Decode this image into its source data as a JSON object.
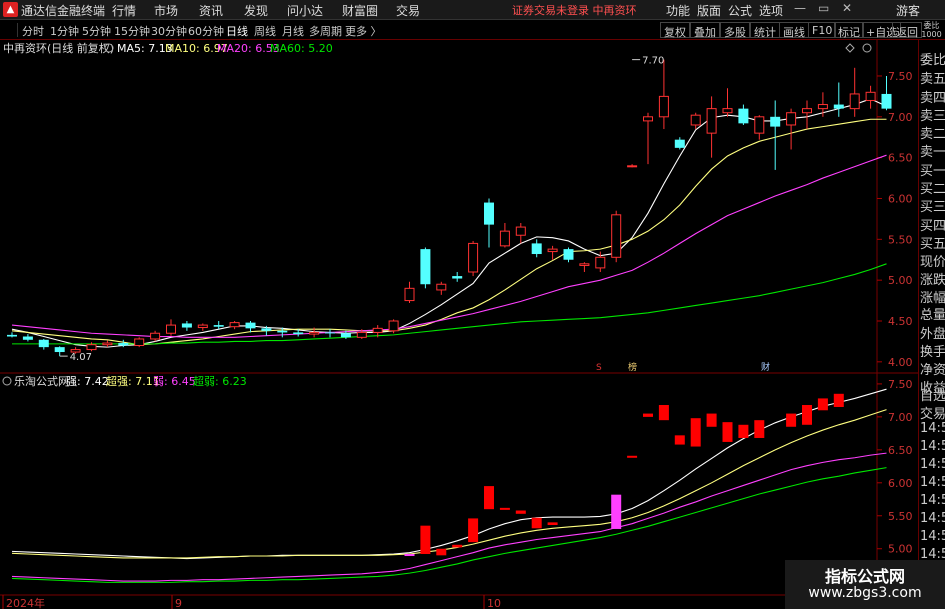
{
  "app": {
    "icon": "app-logo-icon",
    "title": "通达信金融终端"
  },
  "menus": [
    "行情",
    "市场",
    "资讯",
    "发现",
    "问小达",
    "财富圈",
    "交易"
  ],
  "status_text": "证券交易未登录  中再资环",
  "right_menus": [
    "功能",
    "版面",
    "公式",
    "选项"
  ],
  "window_controls": [
    "—",
    "▭",
    "✕"
  ],
  "guest_label": "游客",
  "periods": [
    "分时",
    "1分钟",
    "5分钟",
    "15分钟",
    "30分钟",
    "60分钟",
    "日线",
    "周线",
    "月线",
    "多周期",
    "更多 〉"
  ],
  "active_period": "日线",
  "toolbar_right": [
    "复权",
    "叠加",
    "多股",
    "统计",
    "画线",
    "F10",
    "标记",
    "+自选",
    "返回"
  ],
  "side_top": [
    "委比",
    "1000"
  ],
  "side_items": [
    "委比",
    "卖五",
    "卖四",
    "卖三",
    "卖二",
    "卖一",
    "买一",
    "买二",
    "买三",
    "买四",
    "买五",
    "现价",
    "涨跌",
    "涨幅",
    "总量",
    "外盘",
    "换手",
    "净资",
    "收益",
    "自选",
    "交易",
    "14:56",
    "14:56",
    "14:56",
    "14:56",
    "14:56",
    "14:56",
    "14:56",
    "14:56"
  ],
  "main_legend": {
    "stock": "中再资环(日线 前复权)",
    "ma5": "MA5: 7.13",
    "ma10": "MA10: 6.97",
    "ma20": "MA20: 6.53",
    "ma60": "MA60: 5.20"
  },
  "sub_legend": {
    "name": "乐淘公式网",
    "strong": "强: 7.42",
    "super_strong": "超强: 7.11",
    "weak": "弱: 6.45",
    "super_weak": "超弱: 6.23"
  },
  "markers": {
    "s_mark": "S",
    "bang_mark": "榜",
    "cai_mark": "财"
  },
  "x_labels": [
    "2024年",
    "9",
    "10"
  ],
  "colors": {
    "up": "#ff3232",
    "down": "#54ffff",
    "ma5": "#ffffff",
    "ma10": "#ffff80",
    "ma20": "#ff40ff",
    "ma60": "#00e600",
    "sub_red": "#ff0000",
    "sub_magenta": "#ff40ff"
  },
  "watermark": {
    "logo": "指标公式网",
    "url": "www.zbgs3.com"
  },
  "chart_data": [
    {
      "type": "candlestick",
      "title": "中再资环(日线 前复权)",
      "y_ticks": [
        4.0,
        4.5,
        5.0,
        5.5,
        6.0,
        6.5,
        7.0,
        7.5
      ],
      "ylim": [
        3.9,
        7.72
      ],
      "annotations": [
        {
          "label": "7.70",
          "index": 39,
          "price": 7.7
        },
        {
          "label": "4.07",
          "index": 3,
          "price": 4.07
        }
      ],
      "ohlc": [
        [
          4.33,
          4.36,
          4.3,
          4.31
        ],
        [
          4.31,
          4.34,
          4.25,
          4.27
        ],
        [
          4.27,
          4.28,
          4.15,
          4.18
        ],
        [
          4.18,
          4.19,
          4.07,
          4.12
        ],
        [
          4.12,
          4.18,
          4.1,
          4.15
        ],
        [
          4.15,
          4.24,
          4.13,
          4.21
        ],
        [
          4.21,
          4.26,
          4.18,
          4.23
        ],
        [
          4.23,
          4.27,
          4.18,
          4.2
        ],
        [
          4.2,
          4.3,
          4.18,
          4.28
        ],
        [
          4.28,
          4.38,
          4.25,
          4.35
        ],
        [
          4.35,
          4.52,
          4.32,
          4.45
        ],
        [
          4.47,
          4.5,
          4.38,
          4.42
        ],
        [
          4.42,
          4.47,
          4.38,
          4.45
        ],
        [
          4.45,
          4.5,
          4.4,
          4.43
        ],
        [
          4.43,
          4.5,
          4.4,
          4.48
        ],
        [
          4.48,
          4.5,
          4.36,
          4.41
        ],
        [
          4.41,
          4.44,
          4.32,
          4.38
        ],
        [
          4.38,
          4.42,
          4.3,
          4.36
        ],
        [
          4.36,
          4.4,
          4.31,
          4.34
        ],
        [
          4.34,
          4.42,
          4.3,
          4.36
        ],
        [
          4.36,
          4.4,
          4.3,
          4.35
        ],
        [
          4.35,
          4.38,
          4.28,
          4.3
        ],
        [
          4.3,
          4.4,
          4.28,
          4.36
        ],
        [
          4.36,
          4.45,
          4.3,
          4.41
        ],
        [
          4.38,
          4.52,
          4.35,
          4.5
        ],
        [
          4.75,
          4.98,
          4.72,
          4.9
        ],
        [
          5.38,
          5.4,
          4.9,
          4.95
        ],
        [
          4.88,
          4.98,
          4.82,
          4.95
        ],
        [
          5.05,
          5.1,
          4.98,
          5.02
        ],
        [
          5.1,
          5.48,
          5.05,
          5.45
        ],
        [
          5.95,
          6.0,
          5.4,
          5.68
        ],
        [
          5.42,
          5.7,
          5.4,
          5.6
        ],
        [
          5.55,
          5.7,
          5.45,
          5.65
        ],
        [
          5.45,
          5.5,
          5.28,
          5.32
        ],
        [
          5.35,
          5.42,
          5.25,
          5.38
        ],
        [
          5.38,
          5.4,
          5.22,
          5.25
        ],
        [
          5.18,
          5.22,
          5.1,
          5.2
        ],
        [
          5.15,
          5.35,
          5.1,
          5.28
        ],
        [
          5.28,
          5.85,
          5.22,
          5.8
        ],
        [
          6.4,
          6.42,
          6.38,
          6.4
        ],
        [
          6.95,
          7.05,
          6.42,
          7.0
        ],
        [
          7.0,
          7.7,
          6.85,
          7.25
        ],
        [
          6.72,
          6.75,
          6.6,
          6.62
        ],
        [
          6.9,
          7.05,
          6.85,
          7.02
        ],
        [
          6.8,
          7.25,
          6.5,
          7.1
        ],
        [
          7.05,
          7.35,
          7.0,
          7.1
        ],
        [
          7.1,
          7.15,
          6.9,
          6.92
        ],
        [
          6.8,
          7.02,
          6.72,
          7.0
        ],
        [
          7.0,
          7.2,
          6.35,
          6.88
        ],
        [
          6.9,
          7.1,
          6.6,
          7.05
        ],
        [
          7.05,
          7.2,
          6.85,
          7.1
        ],
        [
          7.1,
          7.3,
          7.0,
          7.15
        ],
        [
          7.15,
          7.42,
          7.0,
          7.1
        ],
        [
          7.1,
          7.6,
          7.0,
          7.28
        ],
        [
          7.2,
          7.38,
          7.1,
          7.3
        ],
        [
          7.28,
          7.5,
          7.08,
          7.1
        ]
      ],
      "series": [
        {
          "name": "MA5",
          "values": [
            4.4,
            4.36,
            4.31,
            4.26,
            4.21,
            4.19,
            4.18,
            4.2,
            4.21,
            4.25,
            4.3,
            4.33,
            4.36,
            4.4,
            4.44,
            4.44,
            4.42,
            4.41,
            4.39,
            4.37,
            4.36,
            4.35,
            4.36,
            4.36,
            4.38,
            4.47,
            4.58,
            4.7,
            4.83,
            4.96,
            5.21,
            5.33,
            5.45,
            5.53,
            5.52,
            5.48,
            5.38,
            5.3,
            5.33,
            5.52,
            5.82,
            6.18,
            6.52,
            6.84,
            6.99,
            7.02,
            7.0,
            6.95,
            6.95,
            6.98,
            7.0,
            7.05,
            7.1,
            7.15,
            7.22,
            7.13
          ]
        },
        {
          "name": "MA10",
          "values": [
            4.38,
            4.36,
            4.34,
            4.32,
            4.3,
            4.28,
            4.27,
            4.24,
            4.21,
            4.22,
            4.24,
            4.26,
            4.28,
            4.31,
            4.34,
            4.37,
            4.38,
            4.39,
            4.4,
            4.4,
            4.4,
            4.39,
            4.38,
            4.38,
            4.38,
            4.41,
            4.45,
            4.52,
            4.6,
            4.66,
            4.76,
            4.88,
            5.01,
            5.14,
            5.24,
            5.35,
            5.36,
            5.38,
            5.43,
            5.5,
            5.6,
            5.74,
            5.92,
            6.15,
            6.36,
            6.52,
            6.62,
            6.7,
            6.75,
            6.8,
            6.85,
            6.88,
            6.91,
            6.94,
            6.97,
            6.97
          ]
        },
        {
          "name": "MA20",
          "values": [
            4.45,
            4.43,
            4.41,
            4.39,
            4.37,
            4.35,
            4.34,
            4.33,
            4.32,
            4.31,
            4.31,
            4.3,
            4.3,
            4.3,
            4.3,
            4.31,
            4.32,
            4.33,
            4.34,
            4.35,
            4.36,
            4.37,
            4.38,
            4.39,
            4.4,
            4.43,
            4.47,
            4.51,
            4.55,
            4.59,
            4.64,
            4.69,
            4.74,
            4.8,
            4.86,
            4.92,
            4.96,
            5.0,
            5.06,
            5.12,
            5.22,
            5.33,
            5.45,
            5.57,
            5.68,
            5.79,
            5.87,
            5.95,
            6.03,
            6.1,
            6.17,
            6.25,
            6.32,
            6.39,
            6.46,
            6.53
          ]
        },
        {
          "name": "MA60",
          "values": [
            4.22,
            4.22,
            4.22,
            4.22,
            4.22,
            4.22,
            4.22,
            4.22,
            4.22,
            4.22,
            4.23,
            4.23,
            4.24,
            4.24,
            4.25,
            4.25,
            4.26,
            4.26,
            4.27,
            4.28,
            4.29,
            4.3,
            4.31,
            4.32,
            4.33,
            4.35,
            4.37,
            4.39,
            4.41,
            4.43,
            4.45,
            4.47,
            4.49,
            4.5,
            4.51,
            4.52,
            4.53,
            4.54,
            4.56,
            4.58,
            4.6,
            4.63,
            4.66,
            4.69,
            4.72,
            4.75,
            4.78,
            4.81,
            4.85,
            4.89,
            4.93,
            4.97,
            5.02,
            5.07,
            5.13,
            5.2
          ]
        }
      ]
    },
    {
      "type": "indicator",
      "title": "乐淘公式网",
      "y_ticks": [
        4.5,
        5.0,
        5.5,
        6.0,
        6.5,
        7.0,
        7.5
      ],
      "ylim": [
        4.45,
        7.62
      ],
      "series": [
        {
          "name": "强",
          "values": [
            4.96,
            4.95,
            4.94,
            4.93,
            4.92,
            4.91,
            4.9,
            4.89,
            4.88,
            4.87,
            4.86,
            4.85,
            4.86,
            4.87,
            4.88,
            4.89,
            4.89,
            4.9,
            4.9,
            4.9,
            4.9,
            4.9,
            4.9,
            4.91,
            4.92,
            4.94,
            4.99,
            5.05,
            5.12,
            5.2,
            5.3,
            5.38,
            5.44,
            5.47,
            5.48,
            5.48,
            5.48,
            5.49,
            5.53,
            5.61,
            5.73,
            5.88,
            6.04,
            6.21,
            6.37,
            6.53,
            6.67,
            6.8,
            6.91,
            7.0,
            7.08,
            7.16,
            7.22,
            7.28,
            7.35,
            7.42
          ]
        },
        {
          "name": "超强",
          "values": [
            4.93,
            4.92,
            4.91,
            4.9,
            4.89,
            4.88,
            4.87,
            4.86,
            4.86,
            4.86,
            4.86,
            4.86,
            4.87,
            4.88,
            4.88,
            4.89,
            4.89,
            4.89,
            4.9,
            4.9,
            4.9,
            4.9,
            4.9,
            4.9,
            4.91,
            4.92,
            4.95,
            4.98,
            5.02,
            5.07,
            5.13,
            5.19,
            5.24,
            5.28,
            5.31,
            5.33,
            5.35,
            5.37,
            5.41,
            5.47,
            5.55,
            5.65,
            5.76,
            5.88,
            6.0,
            6.13,
            6.26,
            6.38,
            6.5,
            6.61,
            6.71,
            6.8,
            6.88,
            6.95,
            7.03,
            7.11
          ]
        },
        {
          "name": "弱",
          "values": [
            4.58,
            4.57,
            4.56,
            4.55,
            4.54,
            4.53,
            4.52,
            4.51,
            4.51,
            4.51,
            4.52,
            4.52,
            4.53,
            4.53,
            4.54,
            4.55,
            4.56,
            4.57,
            4.58,
            4.59,
            4.6,
            4.61,
            4.62,
            4.64,
            4.66,
            4.7,
            4.76,
            4.82,
            4.88,
            4.94,
            5.01,
            5.06,
            5.1,
            5.14,
            5.17,
            5.2,
            5.23,
            5.26,
            5.32,
            5.38,
            5.46,
            5.54,
            5.63,
            5.71,
            5.8,
            5.88,
            5.96,
            6.04,
            6.12,
            6.2,
            6.26,
            6.31,
            6.35,
            6.38,
            6.42,
            6.45
          ]
        },
        {
          "name": "超弱",
          "values": [
            4.55,
            4.54,
            4.53,
            4.52,
            4.51,
            4.5,
            4.49,
            4.49,
            4.49,
            4.49,
            4.49,
            4.5,
            4.5,
            4.51,
            4.51,
            4.52,
            4.52,
            4.53,
            4.53,
            4.54,
            4.55,
            4.56,
            4.57,
            4.58,
            4.6,
            4.63,
            4.67,
            4.72,
            4.77,
            4.83,
            4.88,
            4.93,
            4.97,
            5.01,
            5.05,
            5.09,
            5.13,
            5.17,
            5.22,
            5.28,
            5.34,
            5.41,
            5.48,
            5.55,
            5.62,
            5.69,
            5.76,
            5.83,
            5.89,
            5.95,
            6.01,
            6.06,
            6.1,
            6.15,
            6.19,
            6.23
          ]
        }
      ],
      "red_blocks": [
        [
          25,
          4.9,
          4.92,
          "magenta"
        ],
        [
          26,
          4.92,
          5.35,
          "red"
        ],
        [
          27,
          4.9,
          5.0,
          "red"
        ],
        [
          28,
          5.02,
          5.06,
          "red"
        ],
        [
          29,
          5.1,
          5.46,
          "red"
        ],
        [
          30,
          5.6,
          5.95,
          "red"
        ],
        [
          31,
          5.6,
          5.62,
          "red"
        ],
        [
          32,
          5.53,
          5.58,
          "red"
        ],
        [
          33,
          5.31,
          5.47,
          "red"
        ],
        [
          34,
          5.36,
          5.4,
          "red"
        ],
        [
          38,
          5.3,
          5.82,
          "magenta"
        ],
        [
          39,
          6.39,
          6.41,
          "red"
        ],
        [
          40,
          7.0,
          7.05,
          "red"
        ],
        [
          41,
          6.95,
          7.18,
          "red"
        ],
        [
          42,
          6.58,
          6.72,
          "red"
        ],
        [
          43,
          6.55,
          6.98,
          "red"
        ],
        [
          44,
          6.85,
          7.05,
          "red"
        ],
        [
          45,
          6.62,
          6.92,
          "red"
        ],
        [
          46,
          6.68,
          6.88,
          "red"
        ],
        [
          47,
          6.68,
          6.95,
          "red"
        ],
        [
          49,
          6.85,
          7.05,
          "red"
        ],
        [
          50,
          6.88,
          7.18,
          "red"
        ],
        [
          51,
          7.1,
          7.28,
          "red"
        ],
        [
          52,
          7.15,
          7.35,
          "red"
        ]
      ]
    }
  ]
}
